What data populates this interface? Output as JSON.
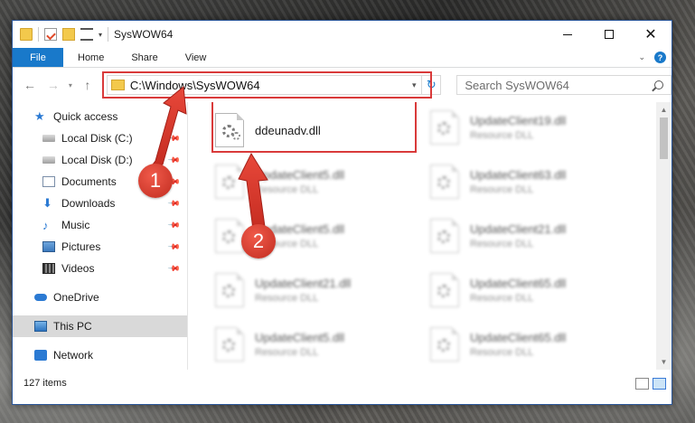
{
  "window": {
    "title": "SysWOW64",
    "controls": {
      "minimize": "",
      "maximize": "",
      "close": "✕"
    }
  },
  "ribbon": {
    "tabs": [
      {
        "label": "File"
      },
      {
        "label": "Home"
      },
      {
        "label": "Share"
      },
      {
        "label": "View"
      }
    ],
    "help_label": "?"
  },
  "navbar": {
    "address": "C:\\Windows\\SysWOW64",
    "search_placeholder": "Search SysWOW64"
  },
  "sidebar": {
    "items": [
      {
        "label": "Quick access",
        "icon": "star-icon"
      },
      {
        "label": "Local Disk (C:)",
        "icon": "drive-icon",
        "pinned": true
      },
      {
        "label": "Local Disk (D:)",
        "icon": "drive-icon",
        "pinned": true
      },
      {
        "label": "Documents",
        "icon": "documents-icon",
        "pinned": true
      },
      {
        "label": "Downloads",
        "icon": "download-icon",
        "pinned": true
      },
      {
        "label": "Music",
        "icon": "music-icon",
        "pinned": true
      },
      {
        "label": "Pictures",
        "icon": "pictures-icon",
        "pinned": true
      },
      {
        "label": "Videos",
        "icon": "videos-icon",
        "pinned": true
      },
      {
        "label": "OneDrive",
        "icon": "cloud-icon"
      },
      {
        "label": "This PC",
        "icon": "computer-icon",
        "selected": true
      },
      {
        "label": "Network",
        "icon": "network-icon"
      }
    ]
  },
  "files": {
    "highlighted": {
      "name": "ddeunadv.dll"
    },
    "column1": [
      {
        "name": "UpdateClient5.dll",
        "type": "Resource DLL"
      },
      {
        "name": "UpdateClient5.dll",
        "type": "Resource DLL"
      },
      {
        "name": "UpdateClient21.dll",
        "type": "Resource DLL"
      },
      {
        "name": "UpdateClient5.dll",
        "type": "Resource DLL"
      }
    ],
    "column2": [
      {
        "name": "UpdateClient19.dll",
        "type": "Resource DLL"
      },
      {
        "name": "UpdateClient63.dll",
        "type": "Resource DLL"
      },
      {
        "name": "UpdateClient21.dll",
        "type": "Resource DLL"
      },
      {
        "name": "UpdateClient65.dll",
        "type": "Resource DLL"
      },
      {
        "name": "UpdateClient65.dll",
        "type": "Resource DLL"
      }
    ]
  },
  "status": {
    "item_count": "127 items"
  },
  "annotations": {
    "step1": "1",
    "step2": "2"
  },
  "colors": {
    "accent": "#1979ca",
    "highlight": "#d93a3a"
  }
}
